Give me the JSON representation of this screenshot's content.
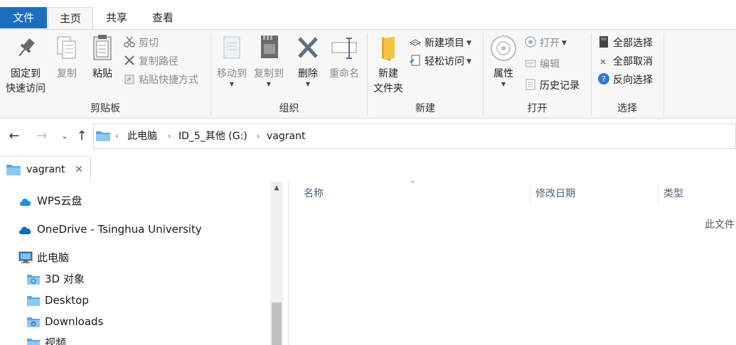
{
  "ribbon_tabs": {
    "file": "文件",
    "home": "主页",
    "share": "共享",
    "view": "查看"
  },
  "clipboard": {
    "label": "剪贴板",
    "pin_line1": "固定到",
    "pin_line2": "快速访问",
    "copy": "复制",
    "paste": "粘贴",
    "cut": "剪切",
    "copy_path": "复制路径",
    "paste_shortcut": "粘贴快捷方式"
  },
  "organize": {
    "label": "组织",
    "move_to": "移动到",
    "copy_to": "复制到",
    "delete": "删除",
    "rename": "重命名"
  },
  "new_group": {
    "label": "新建",
    "new_folder_line1": "新建",
    "new_folder_line2": "文件夹",
    "new_item": "新建项目",
    "easy_access": "轻松访问"
  },
  "open_group": {
    "label": "打开",
    "properties": "属性",
    "open": "打开",
    "edit": "编辑",
    "history": "历史记录"
  },
  "select_group": {
    "label": "选择",
    "select_all": "全部选择",
    "select_none": "全部取消",
    "invert": "反向选择"
  },
  "address": {
    "crumbs": [
      "此电脑",
      "ID_5_其他 (G:)",
      "vagrant"
    ]
  },
  "folder_tab": {
    "label": "vagrant"
  },
  "nav_pane": {
    "items": [
      "WPS云盘",
      "OneDrive - Tsinghua University",
      "此电脑",
      "3D 对象",
      "Desktop",
      "Downloads",
      "视频"
    ]
  },
  "content": {
    "columns": [
      "名称",
      "修改日期",
      "类型"
    ],
    "empty_text": "此文件"
  },
  "colors": {
    "accent": "#1a6ec1",
    "folder": "#f5c342",
    "onedrive": "#0f6cbd"
  }
}
